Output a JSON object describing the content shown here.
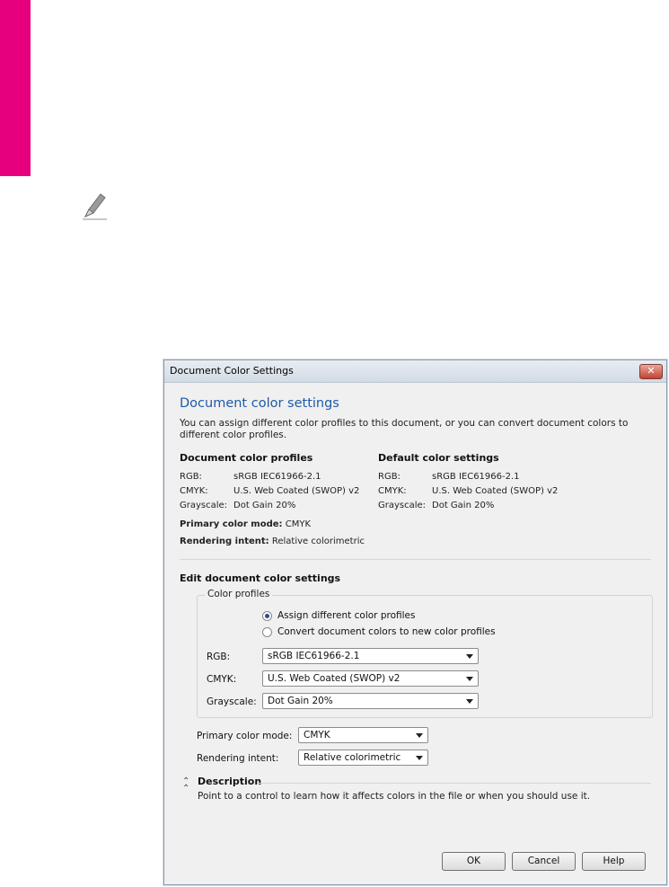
{
  "colors": {
    "accent": "#e6007e"
  },
  "icons": {
    "note": "pencil-icon",
    "close": "close-icon",
    "collapse": "double-chevron-up-icon",
    "dropdown": "chevron-down-icon"
  },
  "dialog": {
    "title": "Document Color Settings",
    "close_label": "✕",
    "heading": "Document color settings",
    "intro": "You can assign different color profiles to this document, or you can convert document colors to different color profiles.",
    "doc_profiles": {
      "title": "Document color profiles",
      "rows": [
        {
          "key": "RGB:",
          "value": "sRGB IEC61966-2.1"
        },
        {
          "key": "CMYK:",
          "value": "U.S. Web Coated (SWOP) v2"
        },
        {
          "key": "Grayscale:",
          "value": "Dot Gain 20%"
        }
      ]
    },
    "default_settings": {
      "title": "Default color settings",
      "rows": [
        {
          "key": "RGB:",
          "value": "sRGB IEC61966-2.1"
        },
        {
          "key": "CMYK:",
          "value": "U.S. Web Coated (SWOP) v2"
        },
        {
          "key": "Grayscale:",
          "value": "Dot Gain 20%"
        }
      ]
    },
    "primary_mode": {
      "label": "Primary color mode:",
      "value": "CMYK"
    },
    "rendering_intent": {
      "label": "Rendering intent:",
      "value": "Relative colorimetric"
    },
    "edit": {
      "title": "Edit document color settings",
      "group_label": "Color profiles",
      "radio_assign": "Assign different color profiles",
      "radio_convert": "Convert document colors to new color profiles",
      "rgb_label": "RGB:",
      "rgb_value": "sRGB IEC61966-2.1",
      "cmyk_label": "CMYK:",
      "cmyk_value": "U.S. Web Coated (SWOP) v2",
      "gray_label": "Grayscale:",
      "gray_value": "Dot Gain 20%",
      "primary_label": "Primary color mode:",
      "primary_value": "CMYK",
      "intent_label": "Rendering intent:",
      "intent_value": "Relative colorimetric"
    },
    "description": {
      "title": "Description",
      "text": "Point to a control to learn how it affects colors in the file or when you should use it."
    },
    "buttons": {
      "ok": "OK",
      "cancel": "Cancel",
      "help": "Help"
    }
  }
}
